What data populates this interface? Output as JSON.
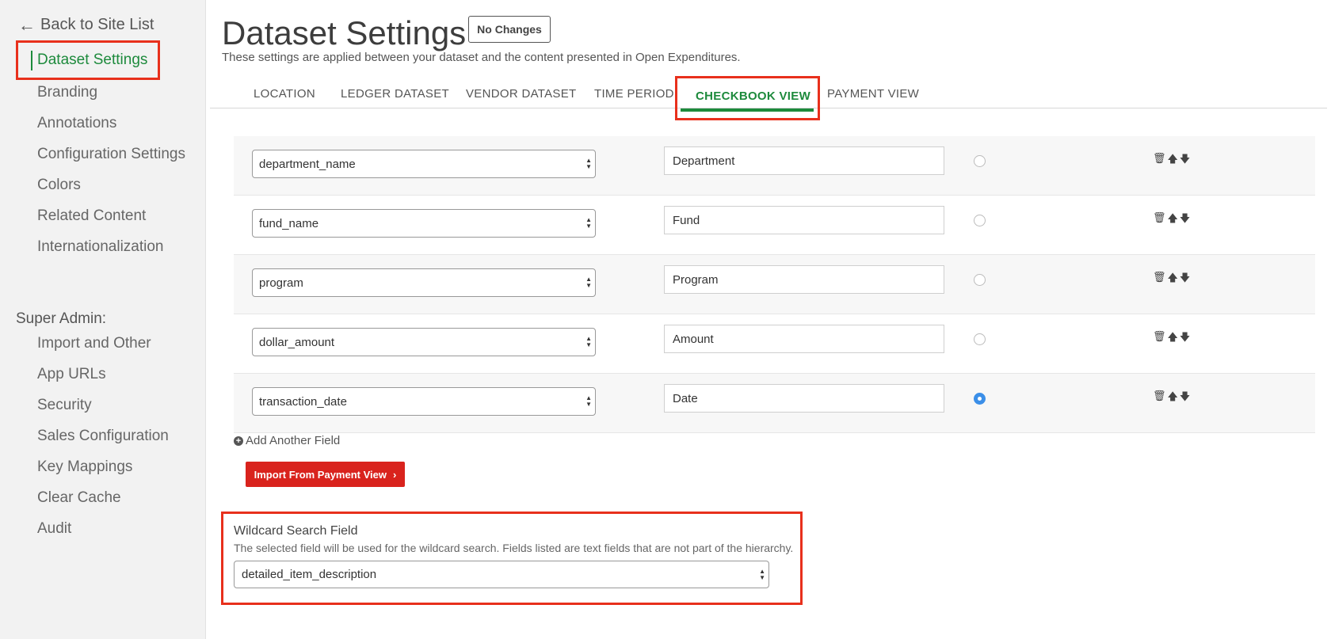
{
  "sidebar": {
    "back_label": "Back to Site List",
    "active_item": "Dataset Settings",
    "items": [
      "Branding",
      "Annotations",
      "Configuration Settings",
      "Colors",
      "Related Content",
      "Internationalization"
    ],
    "super_admin_heading": "Super Admin:",
    "admin_items": [
      "Import and Other",
      "App URLs",
      "Security",
      "Sales Configuration",
      "Key Mappings",
      "Clear Cache",
      "Audit"
    ]
  },
  "header": {
    "title": "Dataset Settings",
    "status_button": "No Changes",
    "subtitle": "These settings are applied between your dataset and the content presented in Open Expenditures."
  },
  "tabs": {
    "items": [
      "LOCATION",
      "LEDGER DATASET",
      "VENDOR DATASET",
      "TIME PERIOD"
    ],
    "active": "CHECKBOOK VIEW",
    "after": "PAYMENT VIEW"
  },
  "fields": [
    {
      "column": "department_name",
      "label": "Department",
      "selected": false
    },
    {
      "column": "fund_name",
      "label": "Fund",
      "selected": false
    },
    {
      "column": "program",
      "label": "Program",
      "selected": false
    },
    {
      "column": "dollar_amount",
      "label": "Amount",
      "selected": false
    },
    {
      "column": "transaction_date",
      "label": "Date",
      "selected": true
    }
  ],
  "add_field_label": "Add Another Field",
  "import_button": "Import From Payment View",
  "wildcard": {
    "title": "Wildcard Search Field",
    "description": "The selected field will be used for the wildcard search. Fields listed are text fields that are not part of the hierarchy.",
    "value": "detailed_item_description"
  },
  "colors": {
    "accent_green": "#1d8a3c",
    "highlight_red": "#e8301c",
    "button_red": "#d9231d",
    "radio_blue": "#3b8fe8"
  }
}
